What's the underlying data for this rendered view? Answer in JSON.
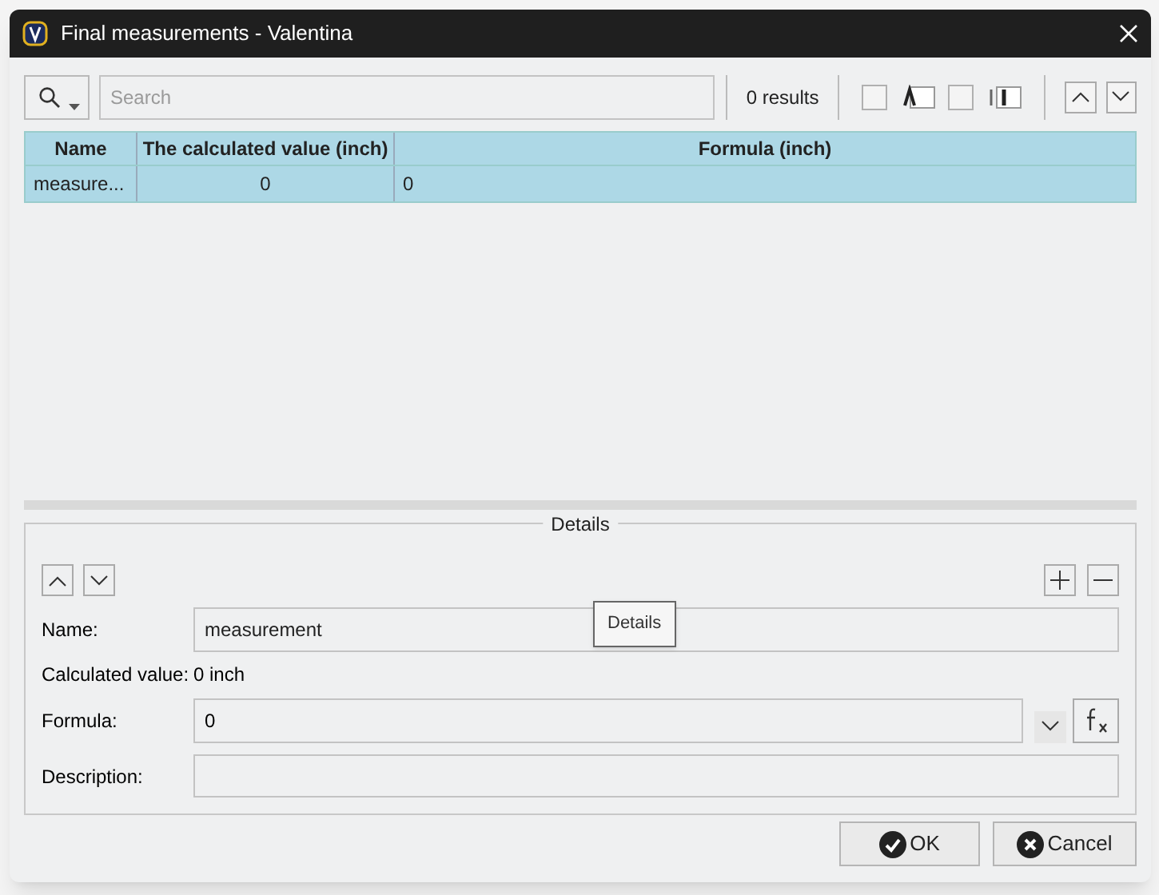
{
  "window": {
    "title": "Final measurements - Valentina"
  },
  "search": {
    "placeholder": "Search",
    "results": "0 results",
    "options": [
      {
        "kind": "match-case",
        "checked": false
      },
      {
        "kind": "whole-word",
        "checked": false
      }
    ]
  },
  "table": {
    "columns": [
      "Name",
      "The calculated value (inch)",
      "Formula (inch)"
    ],
    "rows": [
      {
        "cells": [
          "measure...",
          "0",
          "0"
        ],
        "selected": true
      }
    ]
  },
  "details": {
    "title": "Details",
    "name_label": "Name:",
    "name_value": "measurement",
    "calculated_label": "Calculated value:",
    "calculated_value": "0 inch",
    "formula_label": "Formula:",
    "formula_value": "0",
    "description_label": "Description:",
    "tooltip": "Details"
  },
  "buttons": [
    {
      "kind": "ok",
      "label": "OK"
    },
    {
      "kind": "cancel",
      "label": "Cancel"
    }
  ]
}
